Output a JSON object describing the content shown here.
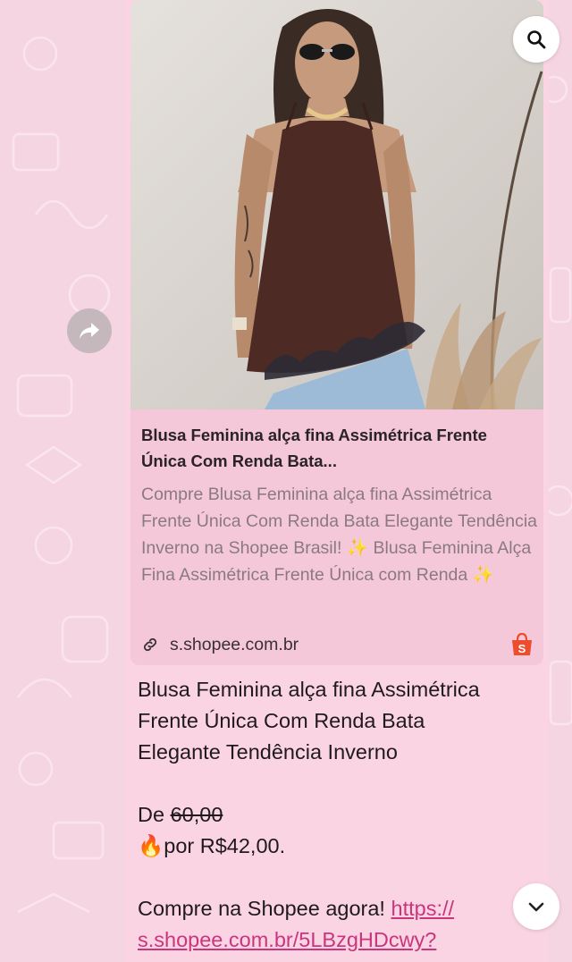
{
  "preview": {
    "title": "Blusa Feminina alça fina Assimétrica Frente Única Com Renda Bata...",
    "description": "Compre Blusa Feminina alça fina Assimétrica Frente Única Com Renda Bata Elegante Tendência Inverno na Shopee Brasil! ✨ Blusa Feminina Alça Fina Assimétrica Frente Única com Renda ✨",
    "domain": "s.shopee.com.br"
  },
  "message": {
    "line1": "Blusa Feminina alça fina Assimétrica",
    "line2": "Frente Única Com Renda Bata",
    "line3": "Elegante Tendência Inverno",
    "price_from_label": "De ",
    "price_old": "60,00",
    "price_new": "🔥por R$42,00.",
    "cta": "Compre na Shopee agora! ",
    "link_part1": "https://",
    "link_part2": "s.shopee.com.br/5LBzgHDcwy?"
  },
  "icons": {
    "search": "search-icon",
    "forward": "forward-icon",
    "scroll_down": "chevron-down-icon",
    "link": "link-icon",
    "shopee": "shopee-bag-icon"
  },
  "colors": {
    "wallpaper": "#f6d5e2",
    "bubble": "#fbd4e3",
    "link": "#c9367e",
    "shopee": "#ee4d2d"
  }
}
